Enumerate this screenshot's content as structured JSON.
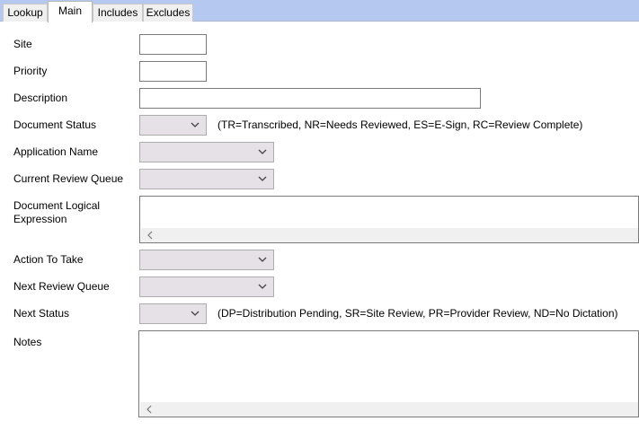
{
  "tabs": [
    "Lookup",
    "Main",
    "Includes",
    "Excludes"
  ],
  "active_tab": "Main",
  "fields": {
    "site": {
      "label": "Site",
      "value": ""
    },
    "priority": {
      "label": "Priority",
      "value": ""
    },
    "description": {
      "label": "Description",
      "value": ""
    },
    "document_status": {
      "label": "Document Status",
      "value": "",
      "hint": "(TR=Transcribed, NR=Needs Reviewed, ES=E-Sign, RC=Review Complete)"
    },
    "application_name": {
      "label": "Application Name",
      "value": ""
    },
    "current_review_queue": {
      "label": "Current Review Queue",
      "value": ""
    },
    "document_logical_expression": {
      "label_line1": "Document Logical",
      "label_line2": "Expression",
      "value": ""
    },
    "action_to_take": {
      "label": "Action To Take",
      "value": ""
    },
    "next_review_queue": {
      "label": "Next Review Queue",
      "value": ""
    },
    "next_status": {
      "label": "Next Status",
      "value": "",
      "hint": "(DP=Distribution Pending, SR=Site Review, PR=Provider Review, ND=No Dictation)"
    },
    "notes": {
      "label": "Notes",
      "value": ""
    }
  },
  "icons": {
    "dropdown": "chevron-down-icon",
    "scroll_left": "scroll-left-arrow-icon"
  },
  "colors": {
    "tabbar": "#b4c8f0",
    "combo_bg": "#e5e1e6",
    "border": "#7a7a7a"
  }
}
